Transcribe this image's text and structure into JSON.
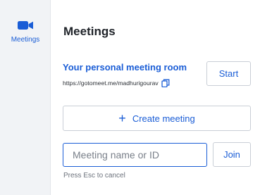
{
  "sidebar": {
    "items": [
      {
        "label": "Meetings",
        "icon": "video-camera-icon",
        "active": true
      }
    ]
  },
  "main": {
    "title": "Meetings",
    "personal_room": {
      "title": "Your personal meeting room",
      "url": "https://gotomeet.me/madhurigourav",
      "copy_icon": "copy-icon",
      "start_label": "Start"
    },
    "create_meeting": {
      "icon": "plus",
      "label": "Create meeting"
    },
    "join": {
      "placeholder": "Meeting name or ID",
      "value": "",
      "join_label": "Join",
      "hint": "Press Esc to cancel"
    }
  },
  "colors": {
    "accent": "#1a5dd6",
    "sidebar_bg": "#f1f3f6",
    "border": "#c9ced6"
  }
}
